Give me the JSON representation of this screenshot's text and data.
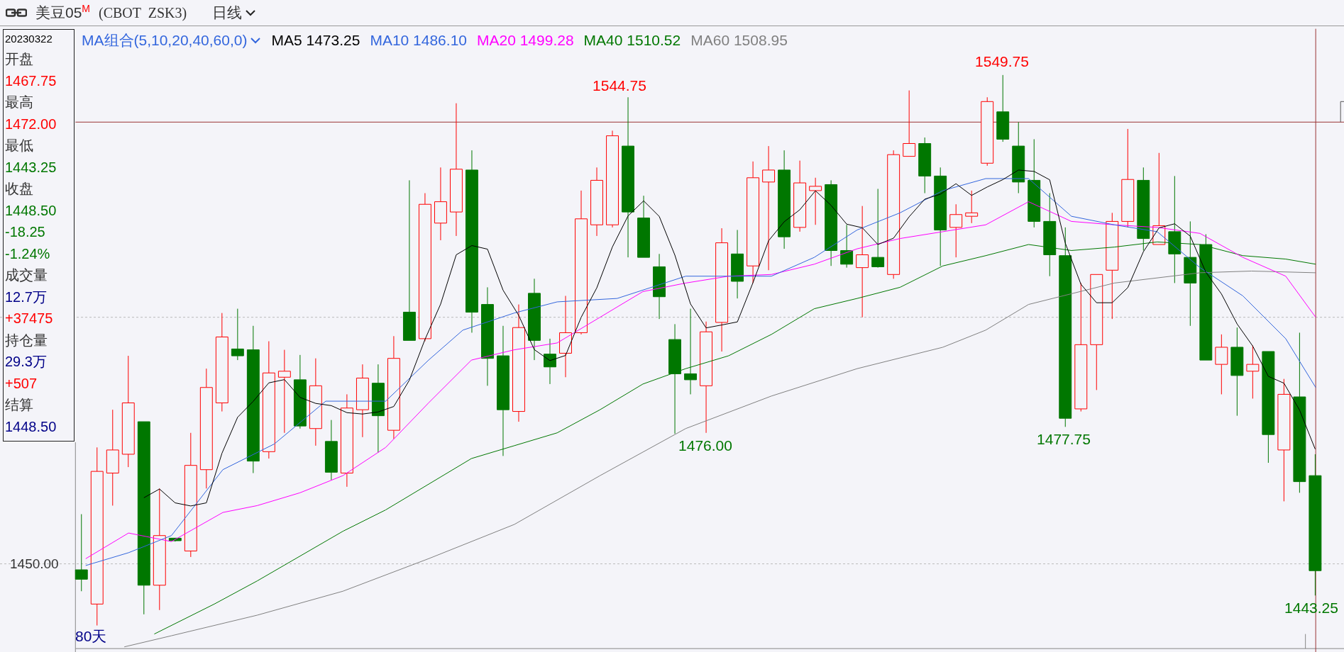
{
  "title_bar": {
    "symbol": "美豆05",
    "superscript": "M",
    "code": "(CBOT  ZSK3)",
    "period": "日线"
  },
  "legend": {
    "selector": "MA组合(5,10,20,40,60,0)",
    "items": [
      {
        "label": "MA5",
        "value": "1473.25",
        "color": "#000000"
      },
      {
        "label": "MA10",
        "value": "1486.10",
        "color": "#3366dd"
      },
      {
        "label": "MA20",
        "value": "1499.28",
        "color": "#ff00ff"
      },
      {
        "label": "MA40",
        "value": "1510.52",
        "color": "#007700"
      },
      {
        "label": "MA60",
        "value": "1508.95",
        "color": "#808080"
      }
    ]
  },
  "info_panel": {
    "date": "20230322",
    "lines": [
      {
        "text": "开盘",
        "color": "#333333"
      },
      {
        "text": "1467.75",
        "color": "#ff0000"
      },
      {
        "text": "最高",
        "color": "#333333"
      },
      {
        "text": "1472.00",
        "color": "#ff0000"
      },
      {
        "text": "最低",
        "color": "#333333"
      },
      {
        "text": "1443.25",
        "color": "#007700"
      },
      {
        "text": "收盘",
        "color": "#333333"
      },
      {
        "text": "1448.50",
        "color": "#007700"
      },
      {
        "text": "-18.25",
        "color": "#007700"
      },
      {
        "text": "-1.24%",
        "color": "#007700"
      },
      {
        "text": "成交量",
        "color": "#333333"
      },
      {
        "text": "12.7万",
        "color": "#000088"
      },
      {
        "text": "+37475",
        "color": "#ff0000"
      },
      {
        "text": "持仓量",
        "color": "#333333"
      },
      {
        "text": "29.3万",
        "color": "#000088"
      },
      {
        "text": "+507",
        "color": "#ff0000"
      },
      {
        "text": "结算",
        "color": "#333333"
      },
      {
        "text": "1448.50",
        "color": "#000088"
      }
    ]
  },
  "chart": {
    "price_labels": [
      {
        "text": "1544.75",
        "color": "#ff0000"
      },
      {
        "text": "1549.75",
        "color": "#ff0000"
      },
      {
        "text": "1476.00",
        "color": "#007700"
      },
      {
        "text": "1477.75",
        "color": "#007700"
      },
      {
        "text": "1443.25",
        "color": "#007700"
      }
    ],
    "axis_label": "1450.00",
    "period_count": "80天"
  }
}
